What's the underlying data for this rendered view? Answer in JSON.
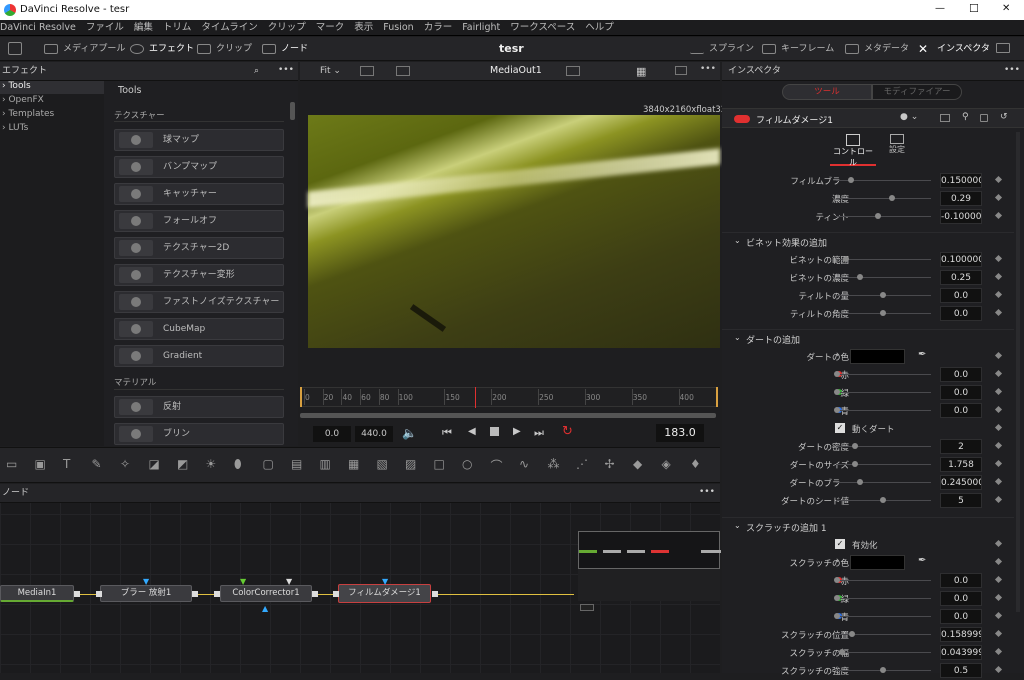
{
  "app": {
    "title": "DaVinci Resolve - tesr",
    "window_min": "—",
    "window_max": "☐",
    "window_close": "✕"
  },
  "menu": [
    "DaVinci Resolve",
    "ファイル",
    "編集",
    "トリム",
    "タイムライン",
    "クリップ",
    "マーク",
    "表示",
    "Fusion",
    "カラー",
    "Fairlight",
    "ワークスペース",
    "ヘルプ"
  ],
  "toolbar": {
    "media_pool": "メディアプール",
    "effects": "エフェクト",
    "clip": "クリップ",
    "nodes": "ノード",
    "project": "tesr",
    "spline": "スプライン",
    "keyframes": "キーフレーム",
    "metadata": "メタデータ",
    "inspector": "インスペクタ"
  },
  "effects": {
    "header": "エフェクト",
    "tree": [
      "Tools",
      "OpenFX",
      "Templates",
      "LUTs"
    ],
    "tools_title": "Tools",
    "cat_texture": "テクスチャー",
    "texture_tools": [
      "球マップ",
      "バンプマップ",
      "キャッチャー",
      "フォールオフ",
      "テクスチャー2D",
      "テクスチャー変形",
      "ファストノイズテクスチャー",
      "CubeMap",
      "Gradient"
    ],
    "cat_material": "マテリアル",
    "material_tools": [
      "反射",
      "ブリン"
    ]
  },
  "viewer": {
    "fit": "Fit",
    "title": "MediaOut1",
    "resolution": "3840x2160xfloat32",
    "ticks": [
      "0",
      "20",
      "40",
      "60",
      "80",
      "100",
      "150",
      "200",
      "250",
      "300",
      "350",
      "400"
    ],
    "start": "0.0",
    "end": "440.0",
    "current": "183.0",
    "playhead_frame": 183,
    "render_range_end": 440
  },
  "nodes_panel": {
    "header": "ノード",
    "nodes": [
      "MediaIn1",
      "ブラー 放射1",
      "ColorCorrector1",
      "フィルムダメージ1"
    ]
  },
  "inspector": {
    "header": "インスペクタ",
    "tab_tools": "ツール",
    "tab_modifiers": "モディファイアー",
    "node_name": "フィルムダメージ1",
    "subtab_controls": "コントロール",
    "subtab_settings": "設定",
    "rows1": [
      {
        "label": "フィルムブラー",
        "value": "0.150000",
        "pos": 0.15
      },
      {
        "label": "濃度",
        "value": "0.29",
        "pos": 0.6
      },
      {
        "label": "ティント",
        "value": "-0.100000",
        "pos": 0.45
      }
    ],
    "sec_vignette": "ビネット効果の追加",
    "rows2": [
      {
        "label": "ビネットの範囲",
        "value": "0.100000",
        "pos": 0.1
      },
      {
        "label": "ビネットの濃度",
        "value": "0.25",
        "pos": 0.25
      },
      {
        "label": "ティルトの量",
        "value": "0.0",
        "pos": 0.5
      },
      {
        "label": "ティルトの角度",
        "value": "0.0",
        "pos": 0.5
      }
    ],
    "sec_dirt": "ダートの追加",
    "dirt_color": "ダートの色",
    "rows3": [
      {
        "label": "赤",
        "value": "0.0",
        "pos": 0,
        "dot": "#e03030"
      },
      {
        "label": "緑",
        "value": "0.0",
        "pos": 0,
        "dot": "#30b030"
      },
      {
        "label": "青",
        "value": "0.0",
        "pos": 0,
        "dot": "#3070e0"
      }
    ],
    "dirt_animate": "動くダート",
    "rows4": [
      {
        "label": "ダートの密度",
        "value": "2",
        "pos": 0.2
      },
      {
        "label": "ダートのサイズ",
        "value": "1.758",
        "pos": 0.2
      },
      {
        "label": "ダートのブラー",
        "value": "0.245000",
        "pos": 0.25
      },
      {
        "label": "ダートのシード値",
        "value": "5",
        "pos": 0.5
      }
    ],
    "sec_scratch": "スクラッチの追加 1",
    "scratch_enabled": "有効化",
    "scratch_color": "スクラッチの色",
    "rows5": [
      {
        "label": "赤",
        "value": "0.0",
        "pos": 0,
        "dot": "#e03030"
      },
      {
        "label": "緑",
        "value": "0.0",
        "pos": 0,
        "dot": "#30b030"
      },
      {
        "label": "青",
        "value": "0.0",
        "pos": 0,
        "dot": "#3070e0"
      }
    ],
    "rows6": [
      {
        "label": "スクラッチの位置",
        "value": "0.158999",
        "pos": 0.16
      },
      {
        "label": "スクラッチの幅",
        "value": "0.043999",
        "pos": 0.05
      },
      {
        "label": "スクラッチの強度",
        "value": "0.5",
        "pos": 0.5
      }
    ]
  }
}
